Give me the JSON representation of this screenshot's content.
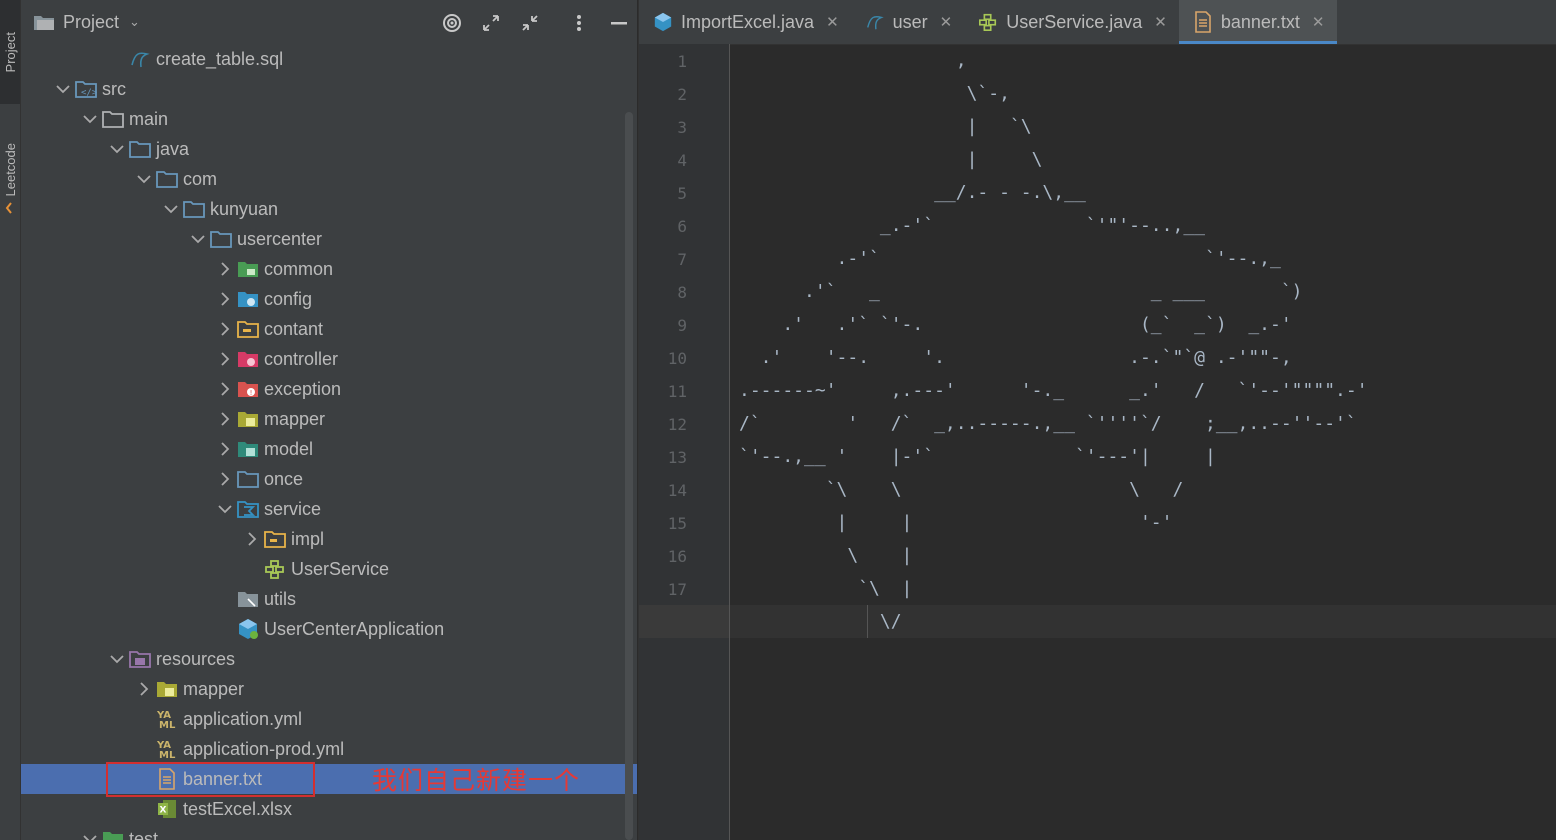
{
  "side_strip": {
    "tabs": [
      {
        "label": "Project"
      },
      {
        "label": "Leetcode"
      }
    ]
  },
  "project_panel": {
    "title": "Project",
    "tree": [
      {
        "label": "create_table.sql",
        "depth": 3,
        "arrow": "",
        "icon": "sql-file-icon",
        "kind": "file"
      },
      {
        "label": "src",
        "depth": 1,
        "arrow": "open",
        "icon": "source-folder-icon",
        "kind": "folder"
      },
      {
        "label": "main",
        "depth": 2,
        "arrow": "open",
        "icon": "folder-icon",
        "kind": "folder"
      },
      {
        "label": "java",
        "depth": 3,
        "arrow": "open",
        "icon": "source-root-folder-icon",
        "kind": "folder"
      },
      {
        "label": "com",
        "depth": 4,
        "arrow": "open",
        "icon": "package-icon",
        "kind": "folder"
      },
      {
        "label": "kunyuan",
        "depth": 5,
        "arrow": "open",
        "icon": "package-icon",
        "kind": "folder"
      },
      {
        "label": "usercenter",
        "depth": 6,
        "arrow": "open",
        "icon": "package-icon",
        "kind": "folder"
      },
      {
        "label": "common",
        "depth": 7,
        "arrow": "closed",
        "icon": "common-package-icon",
        "kind": "folder"
      },
      {
        "label": "config",
        "depth": 7,
        "arrow": "closed",
        "icon": "config-package-icon",
        "kind": "folder"
      },
      {
        "label": "contant",
        "depth": 7,
        "arrow": "closed",
        "icon": "constant-package-icon",
        "kind": "folder"
      },
      {
        "label": "controller",
        "depth": 7,
        "arrow": "closed",
        "icon": "controller-package-icon",
        "kind": "folder"
      },
      {
        "label": "exception",
        "depth": 7,
        "arrow": "closed",
        "icon": "exception-package-icon",
        "kind": "folder"
      },
      {
        "label": "mapper",
        "depth": 7,
        "arrow": "closed",
        "icon": "mapper-package-icon",
        "kind": "folder"
      },
      {
        "label": "model",
        "depth": 7,
        "arrow": "closed",
        "icon": "model-package-icon",
        "kind": "folder"
      },
      {
        "label": "once",
        "depth": 7,
        "arrow": "closed",
        "icon": "package-icon",
        "kind": "folder"
      },
      {
        "label": "service",
        "depth": 7,
        "arrow": "open",
        "icon": "service-package-icon",
        "kind": "folder"
      },
      {
        "label": "impl",
        "depth": 8,
        "arrow": "closed",
        "icon": "impl-package-icon",
        "kind": "folder"
      },
      {
        "label": "UserService",
        "depth": 8,
        "arrow": "",
        "icon": "interface-icon",
        "kind": "file"
      },
      {
        "label": "utils",
        "depth": 7,
        "arrow": "",
        "icon": "utils-package-icon",
        "kind": "folder"
      },
      {
        "label": "UserCenterApplication",
        "depth": 7,
        "arrow": "",
        "icon": "spring-boot-app-icon",
        "kind": "file"
      },
      {
        "label": "resources",
        "depth": 3,
        "arrow": "open",
        "icon": "resources-folder-icon",
        "kind": "folder"
      },
      {
        "label": "mapper",
        "depth": 4,
        "arrow": "closed",
        "icon": "mapper-package-icon",
        "kind": "folder"
      },
      {
        "label": "application.yml",
        "depth": 4,
        "arrow": "",
        "icon": "yaml-file-icon",
        "kind": "file"
      },
      {
        "label": "application-prod.yml",
        "depth": 4,
        "arrow": "",
        "icon": "yaml-file-icon",
        "kind": "file"
      },
      {
        "label": "banner.txt",
        "depth": 4,
        "arrow": "",
        "icon": "text-file-icon",
        "kind": "file",
        "selected": true
      },
      {
        "label": "testExcel.xlsx",
        "depth": 4,
        "arrow": "",
        "icon": "excel-file-icon",
        "kind": "file"
      },
      {
        "label": "test",
        "depth": 2,
        "arrow": "open",
        "icon": "test-folder-icon",
        "kind": "folder"
      }
    ],
    "annotation": "我们自己新建一个"
  },
  "editor": {
    "tabs": [
      {
        "label": "ImportExcel.java",
        "icon": "java-class-icon",
        "active": false
      },
      {
        "label": "user",
        "icon": "sql-file-icon",
        "active": false
      },
      {
        "label": "UserService.java",
        "icon": "interface-icon",
        "active": false
      },
      {
        "label": "banner.txt",
        "icon": "text-file-icon",
        "active": true
      }
    ],
    "current_line": 18,
    "lines": [
      "                    ,",
      "                     \\`-,",
      "                     |   `\\",
      "                     |     \\",
      "                  __/.- - -.\\,__",
      "             _.-'`              `'\"'--..,__",
      "         .-'`                              `'--.,_",
      "      .'`   _                         _ ___       `)",
      "    .'   .'` `'-.                    (_`  _`)  _.-'",
      "  .'    '--.     '.                 .-.`\"`@ .-'\"\"-,",
      ".------~'     ,.---'      '-._      _.'   /   `'--'\"\"\"\".-'",
      "/`        '   /`  _,..-----.,__ `''''`/    ;__,..--''--'`",
      "`'--.,__ '    |-'`             `'---'|     |",
      "        `\\    \\                     \\   /",
      "         |     |                     '-'",
      "          \\    |",
      "           `\\  |",
      "             \\/"
    ]
  }
}
